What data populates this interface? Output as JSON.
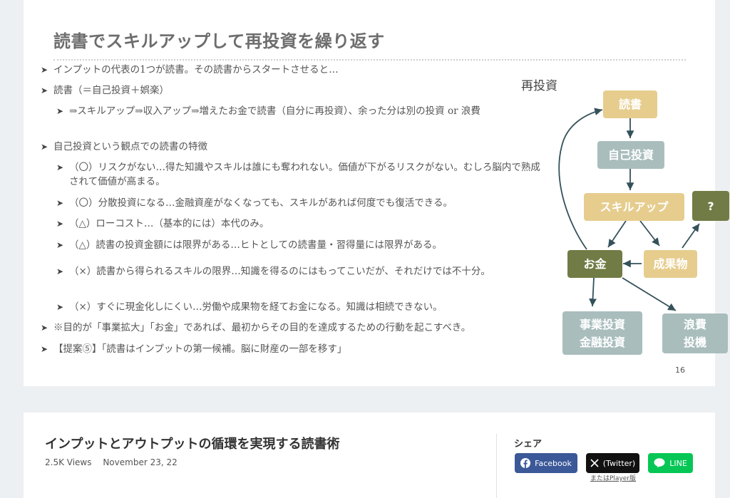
{
  "slide": {
    "title": "読書でスキルアップして再投資を繰り返す",
    "page_number": "16",
    "bullets": [
      {
        "level": 1,
        "text": "インプットの代表の1つが読書。その読書からスタートさせると…"
      },
      {
        "level": 1,
        "text": "読書（＝自己投資＋娯楽）"
      },
      {
        "level": 2,
        "text": "⇒スキルアップ⇒収入アップ⇒増えたお金で読書（自分に再投資）、余った分は別の投資 or 浪費"
      },
      {
        "level": 1,
        "text": "自己投資という観点での読書の特徴"
      },
      {
        "level": 2,
        "text": "（〇）リスクがない…得た知識やスキルは誰にも奪われない。価値が下がるリスクがない。むしろ脳内で熟成されて価値が高まる。"
      },
      {
        "level": 2,
        "text": "（〇）分散投資になる…金融資産がなくなっても、スキルがあれば何度でも復活できる。"
      },
      {
        "level": 2,
        "text": "（△）ローコスト…（基本的には）本代のみ。"
      },
      {
        "level": 2,
        "text": "（△）読書の投資金額には限界がある…ヒトとしての読書量・習得量には限界がある。"
      },
      {
        "level": 2,
        "text": "（×）読書から得られるスキルの限界…知識を得るのにはもってこいだが、それだけでは不十分。"
      },
      {
        "level": 2,
        "text": "（×）すぐに現金化しにくい…労働や成果物を経てお金になる。知識は相続できない。"
      },
      {
        "level": 1,
        "text": "※目的が「事業拡大」「お金」であれば、最初からその目的を達成するための行動を起こすべき。"
      },
      {
        "level": 1,
        "text": "【提案⑤】「読書はインプットの第一候補。脳に財産の一部を移す」"
      }
    ],
    "diagram": {
      "label": "再投資",
      "nodes": {
        "reading": "読書",
        "self_investment": "自己投資",
        "skill_up": "スキルアップ",
        "question": "?",
        "money": "お金",
        "deliverables": "成果物",
        "business_investment": "事業投資\n金融投資",
        "waste": "浪費\n投機"
      },
      "colors": {
        "gold": "#e6cd8e",
        "teal": "#a9bdbd",
        "olive": "#717b45",
        "arrow": "#35515a"
      }
    }
  },
  "info": {
    "title": "インプットとアウトプットの循環を実現する読書術",
    "views": "2.5K Views",
    "date": "November 23, 22"
  },
  "share": {
    "label": "シェア",
    "facebook": "Facebook",
    "twitter": "(Twitter)",
    "line": "LINE",
    "player_link": "またはPlayer版"
  }
}
